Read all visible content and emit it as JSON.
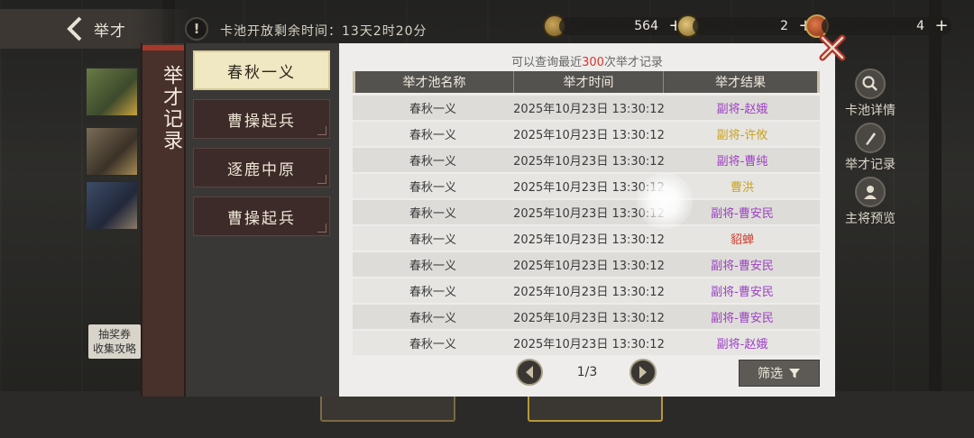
{
  "header": {
    "back_label": "举才",
    "timer_text": "卡池开放剩余时间：13天2时20分",
    "resources": [
      {
        "icon": "coin-icon",
        "value": "564"
      },
      {
        "icon": "token-icon",
        "value": "2"
      },
      {
        "icon": "gem-icon",
        "value": "4"
      }
    ]
  },
  "hint": {
    "line1": "抽奖券",
    "line2": "收集攻略"
  },
  "side_menu": [
    {
      "icon": "magnifier-icon",
      "label": "卡池详情"
    },
    {
      "icon": "brush-icon",
      "label": "举才记录"
    },
    {
      "icon": "general-icon",
      "label": "主将预览"
    }
  ],
  "modal": {
    "title": "举才记录",
    "tabs": [
      "春秋一义",
      "曹操起兵",
      "逐鹿中原",
      "曹操起兵"
    ],
    "active_tab": 0,
    "subtitle_prefix": "可以查询最近",
    "subtitle_count": "300",
    "subtitle_suffix": "次举才记录",
    "columns": [
      "举才池名称",
      "举才时间",
      "举才结果"
    ],
    "rows": [
      {
        "pool": "春秋一义",
        "time": "2025年10月23日 13:30:12",
        "result": "副将-赵娥",
        "color": "#9b3fc4"
      },
      {
        "pool": "春秋一义",
        "time": "2025年10月23日 13:30:12",
        "result": "副将-许攸",
        "color": "#c9a21c"
      },
      {
        "pool": "春秋一义",
        "time": "2025年10月23日 13:30:12",
        "result": "副将-曹纯",
        "color": "#9b3fc4"
      },
      {
        "pool": "春秋一义",
        "time": "2025年10月23日 13:30:12",
        "result": "曹洪",
        "color": "#c9a21c"
      },
      {
        "pool": "春秋一义",
        "time": "2025年10月23日 13:30:12",
        "result": "副将-曹安民",
        "color": "#9b3fc4"
      },
      {
        "pool": "春秋一义",
        "time": "2025年10月23日 13:30:12",
        "result": "貂蝉",
        "color": "#d23a2c"
      },
      {
        "pool": "春秋一义",
        "time": "2025年10月23日 13:30:12",
        "result": "副将-曹安民",
        "color": "#9b3fc4"
      },
      {
        "pool": "春秋一义",
        "time": "2025年10月23日 13:30:12",
        "result": "副将-曹安民",
        "color": "#9b3fc4"
      },
      {
        "pool": "春秋一义",
        "time": "2025年10月23日 13:30:12",
        "result": "副将-曹安民",
        "color": "#9b3fc4"
      },
      {
        "pool": "春秋一义",
        "time": "2025年10月23日 13:30:12",
        "result": "副将-赵娥",
        "color": "#9b3fc4"
      }
    ],
    "page_text": "1/3",
    "filter_label": "筛选"
  }
}
